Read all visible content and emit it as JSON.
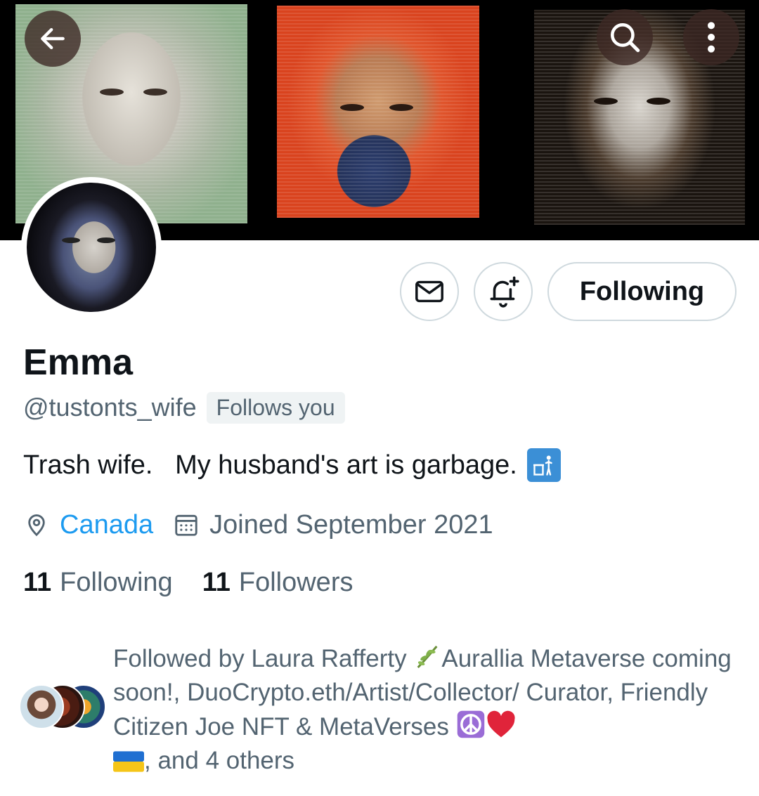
{
  "header": {
    "back_icon": "arrow-left-icon",
    "search_icon": "search-icon",
    "more_icon": "more-vertical-icon"
  },
  "actions": {
    "message_icon": "envelope-icon",
    "notify_icon": "bell-plus-icon",
    "following_label": "Following"
  },
  "profile": {
    "display_name": "Emma",
    "handle": "@tustonts_wife",
    "follows_you": "Follows you",
    "bio": "Trash wife.   My husband's art is garbage.",
    "bio_emoji": "trash-can-emoji",
    "location": "Canada",
    "joined": "Joined September 2021",
    "following_count": "11",
    "following_label": "Following",
    "followers_count": "11",
    "followers_label": "Followers"
  },
  "followed_by": {
    "prefix": "Followed by Laura Rafferty ",
    "part1": "Aurallia Metaverse coming soon!, DuoCrypto.eth/Artist/Collector/ Curator, Friendly Citizen Joe NFT & MetaVerses ",
    "suffix": ", and 4 others",
    "emojis": [
      "herb-emoji",
      "peace-symbol-emoji",
      "red-heart-emoji",
      "ukraine-flag-emoji"
    ]
  },
  "colors": {
    "link": "#1d9bf0",
    "secondary_text": "#536471",
    "primary_text": "#0f1419",
    "border": "#cfd9de"
  }
}
